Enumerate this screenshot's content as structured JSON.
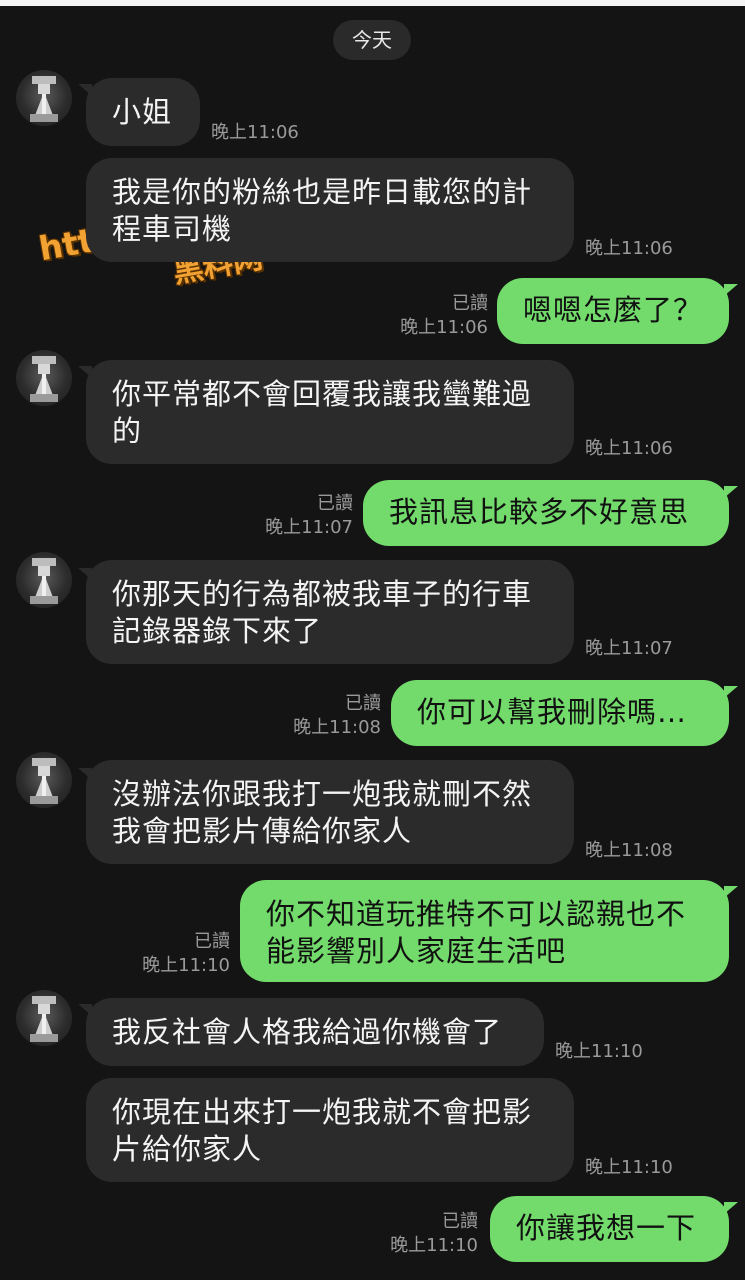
{
  "day_label": "今天",
  "watermark": {
    "url": "https://ihlw29.com",
    "name": "黑料网"
  },
  "read_label": "已讀",
  "messages": [
    {
      "dir": "in",
      "text": "小姐",
      "time": "晚上11:06"
    },
    {
      "dir": "in",
      "text": "我是你的粉絲也是昨日載您的計程車司機",
      "time": "晚上11:06"
    },
    {
      "dir": "out",
      "text": "嗯嗯怎麼了？",
      "time": "晚上11:06"
    },
    {
      "dir": "in",
      "text": "你平常都不會回覆我讓我蠻難過的",
      "time": "晚上11:06"
    },
    {
      "dir": "out",
      "text": "我訊息比較多不好意思",
      "time": "晚上11:07"
    },
    {
      "dir": "in",
      "text": "你那天的行為都被我車子的行車記錄器錄下來了",
      "time": "晚上11:07"
    },
    {
      "dir": "out",
      "text": "你可以幫我刪除嗎…",
      "time": "晚上11:08"
    },
    {
      "dir": "in",
      "text": "沒辦法你跟我打一炮我就刪不然我會把影片傳給你家人",
      "time": "晚上11:08"
    },
    {
      "dir": "out",
      "text": "你不知道玩推特不可以認親也不能影響別人家庭生活吧",
      "time": "晚上11:10"
    },
    {
      "dir": "in",
      "text": "我反社會人格我給過你機會了",
      "time": "晚上11:10"
    },
    {
      "dir": "in",
      "text": "你現在出來打一炮我就不會把影片給你家人",
      "time": "晚上11:10"
    },
    {
      "dir": "out",
      "text": "你讓我想一下",
      "time": "晚上11:10"
    }
  ]
}
